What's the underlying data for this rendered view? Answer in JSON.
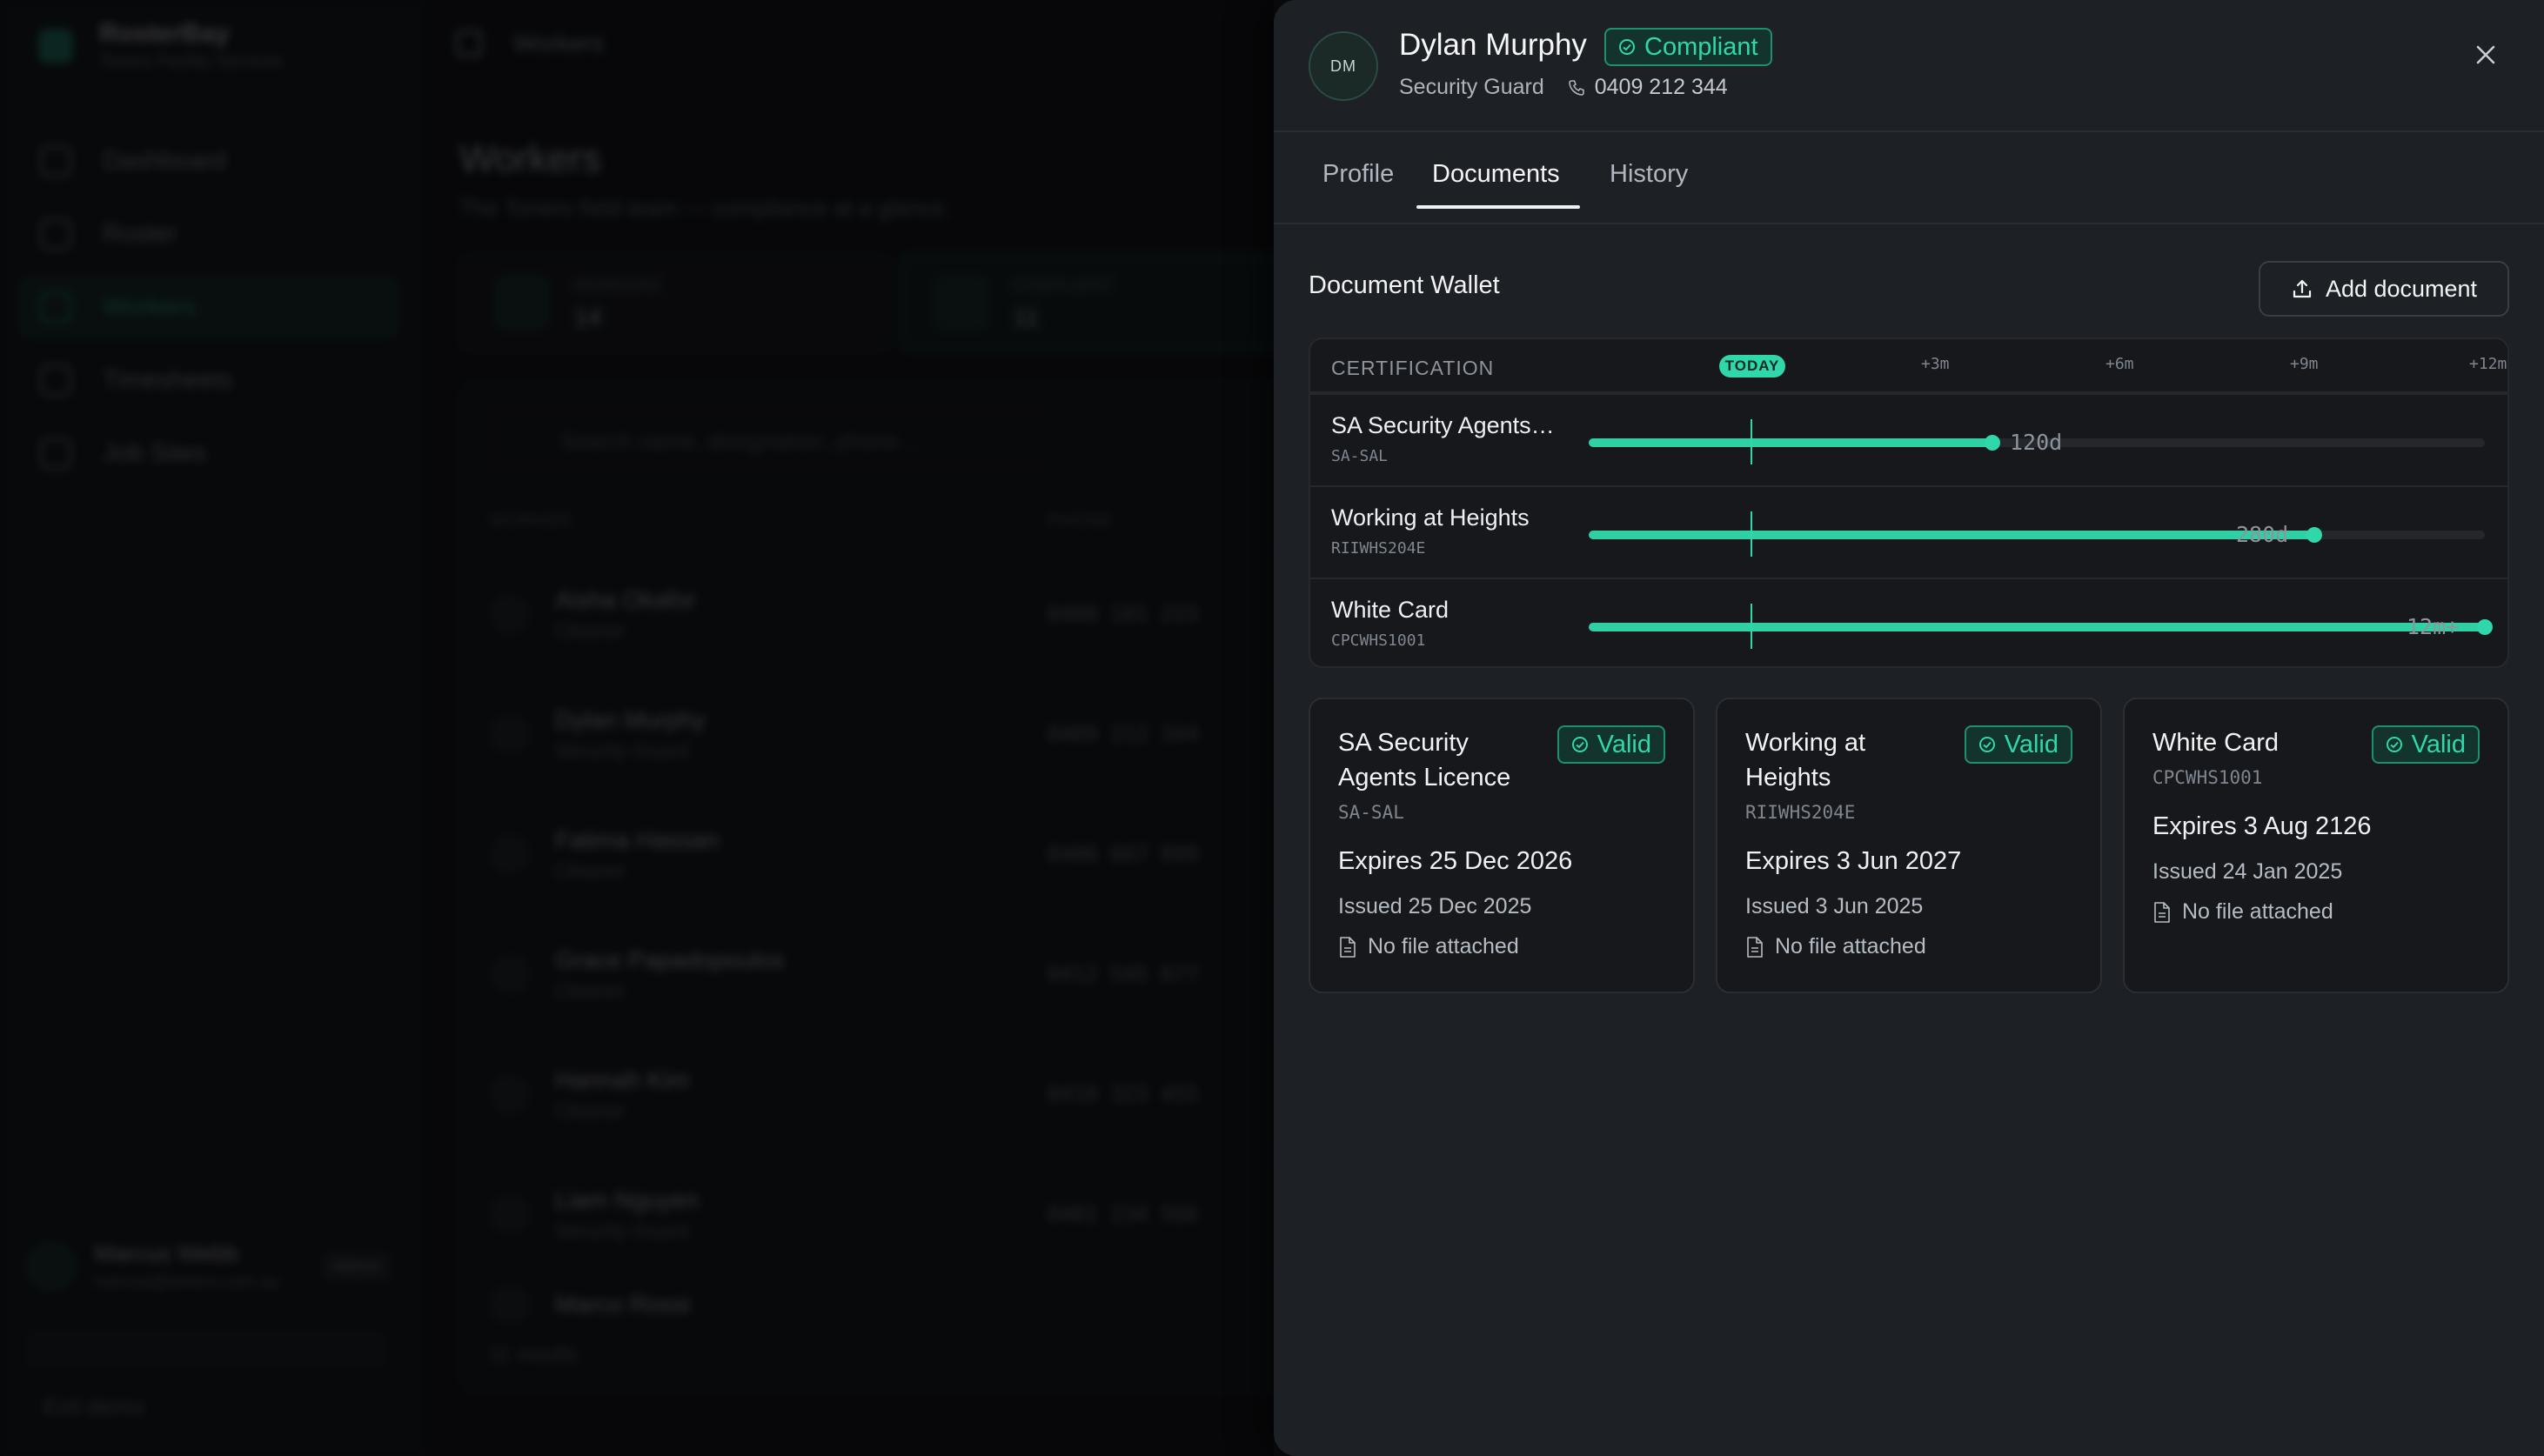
{
  "background": {
    "brand": {
      "name": "RosterBay",
      "subtitle": "Tonero Facility Services"
    },
    "nav": [
      "Dashboard",
      "Roster",
      "Workers",
      "Timesheets",
      "Job Sites"
    ],
    "user": {
      "name": "Marcus Webb",
      "email": "marcus@tonero.com.au",
      "role": "Admin"
    },
    "exit_label": "Exit demo",
    "topbar_label": "Workers",
    "page_title": "Workers",
    "page_subtitle": "The Tonero field team — compliance at a glance.",
    "stats": [
      {
        "label": "WORKERS",
        "value": "14"
      },
      {
        "label": "COMPLIANT",
        "value": "11"
      }
    ],
    "search_placeholder": "Search name, designation, phone…",
    "columns": [
      "WORKER",
      "PHONE"
    ],
    "rows": [
      {
        "initials": "AO",
        "name": "Aisha Okafor",
        "role": "Cleaner",
        "phone": "0408 101 233"
      },
      {
        "initials": "DM",
        "name": "Dylan Murphy",
        "role": "Security Guard",
        "phone": "0409 212 344"
      },
      {
        "initials": "FH",
        "name": "Fatima Hassan",
        "role": "Cleaner",
        "phone": "0406 667 899"
      },
      {
        "initials": "GP",
        "name": "Grace Papadopoulos",
        "role": "Cleaner",
        "phone": "0412 545 677"
      },
      {
        "initials": "HK",
        "name": "Hannah Kim",
        "role": "Cleaner",
        "phone": "0410 323 455"
      },
      {
        "initials": "LN",
        "name": "Liam Nguyen",
        "role": "Security Guard",
        "phone": "0401 234 566"
      },
      {
        "initials": "MR",
        "name": "Marco Rossi",
        "role": "",
        "phone": ""
      }
    ],
    "results": "11 results"
  },
  "drawer": {
    "avatar_initials": "DM",
    "name": "Dylan Murphy",
    "status_badge": "Compliant",
    "designation": "Security Guard",
    "phone": "0409 212 344",
    "tabs": [
      "Profile",
      "Documents",
      "History"
    ],
    "active_tab": "Documents",
    "section_title": "Document Wallet",
    "add_button": "Add document",
    "timeline": {
      "header_label": "CERTIFICATION",
      "today_label": "TODAY",
      "ticks": [
        "+3m",
        "+6m",
        "+9m",
        "+12m"
      ],
      "rows": [
        {
          "name": "SA Security Agents…",
          "code": "SA-SAL",
          "days_label": "120d",
          "fill_fraction": 0.45
        },
        {
          "name": "Working at Heights",
          "code": "RIIWHS204E",
          "days_label": "280d",
          "fill_fraction": 0.81
        },
        {
          "name": "White Card",
          "code": "CPCWHS1001",
          "days_label": "12m+",
          "fill_fraction": 1.0
        }
      ]
    },
    "cards": [
      {
        "title": "SA Security Agents Licence",
        "badge": "Valid",
        "code": "SA-SAL",
        "expires": "Expires 25 Dec 2026",
        "issued": "Issued 25 Dec 2025",
        "file": "No file attached"
      },
      {
        "title": "Working at Heights",
        "badge": "Valid",
        "code": "RIIWHS204E",
        "expires": "Expires 3 Jun 2027",
        "issued": "Issued 3 Jun 2025",
        "file": "No file attached"
      },
      {
        "title": "White Card",
        "badge": "Valid",
        "code": "CPCWHS1001",
        "expires": "Expires 3 Aug 2126",
        "issued": "Issued 24 Jan 2025",
        "file": "No file attached"
      }
    ]
  },
  "colors": {
    "accent": "#2fd7aa",
    "panel": "#1d2025",
    "card": "#16181c"
  }
}
